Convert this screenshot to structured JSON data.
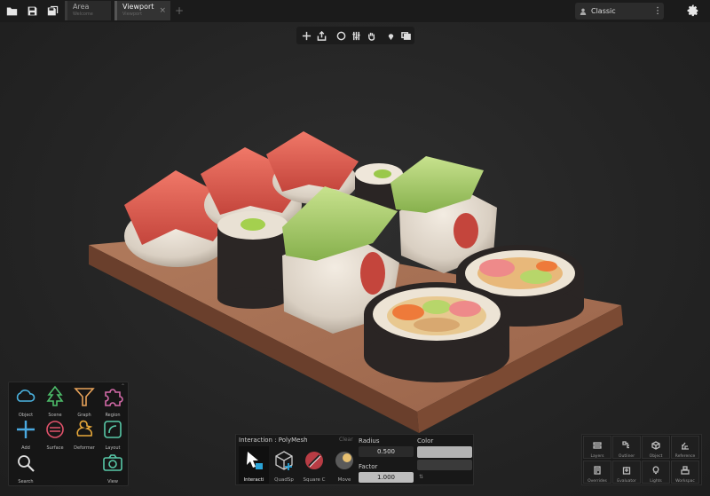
{
  "toolbar": {
    "icons": [
      "folder-icon",
      "save-icon",
      "save-all-icon"
    ]
  },
  "tabs": [
    {
      "title": "Area",
      "subtitle": "Welcome"
    },
    {
      "title": "Viewport",
      "subtitle": "Viewport",
      "close": "×"
    }
  ],
  "tab_add": "+",
  "mode_select": {
    "label": "Classic",
    "menu": "⋮"
  },
  "viewport_toolbar": {
    "icons": [
      "add-icon",
      "export-icon",
      "sphere-icon",
      "sliders-icon",
      "hand-icon",
      "pin-icon",
      "windows-icon"
    ]
  },
  "palette": {
    "corner": "⌃",
    "items": [
      {
        "label": "Object",
        "color": "#4bb3e0"
      },
      {
        "label": "Scene",
        "color": "#4dbd6a"
      },
      {
        "label": "Graph",
        "color": "#e8a35a"
      },
      {
        "label": "Region",
        "color": "#d46aa8"
      },
      {
        "label": "Add",
        "color": "#4aa9e0"
      },
      {
        "label": "Surface",
        "color": "#e0526a"
      },
      {
        "label": "Deformer",
        "color": "#e8a83a"
      },
      {
        "label": "Layout",
        "color": "#58c9a8"
      },
      {
        "label": "Search",
        "color": "#e0e0e0"
      },
      {
        "label": "View",
        "color": "#58c9a8"
      }
    ]
  },
  "interaction": {
    "title": "Interaction : PolyMesh",
    "clear": "Clear",
    "tools": [
      {
        "label": "Interacti"
      },
      {
        "label": "QuadSp"
      },
      {
        "label": "Square C"
      },
      {
        "label": "Move"
      }
    ],
    "radius_label": "Radius",
    "radius_value": "0.500",
    "factor_label": "Factor",
    "factor_value": "1.000",
    "color_label": "Color",
    "swap": "⇅"
  },
  "right_panel": {
    "buttons": [
      {
        "label": "Layers"
      },
      {
        "label": "Outliner"
      },
      {
        "label": "Object"
      },
      {
        "label": "Reference"
      },
      {
        "label": "Overrides"
      },
      {
        "label": "Evaluator"
      },
      {
        "label": "Lights"
      },
      {
        "label": "Workspac"
      }
    ]
  }
}
